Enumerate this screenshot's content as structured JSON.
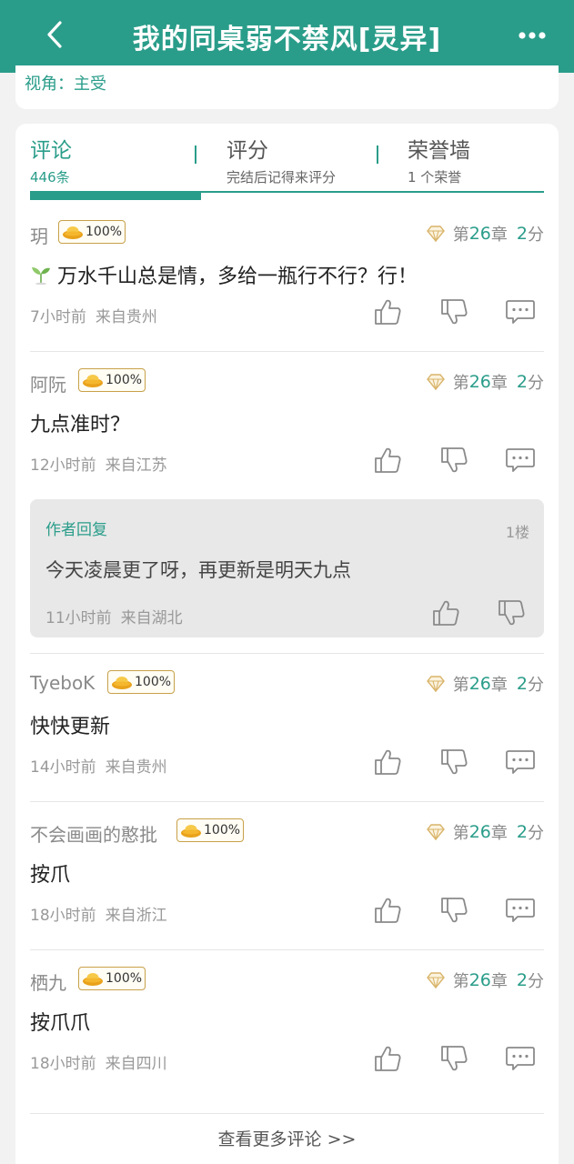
{
  "header": {
    "title": "我的同桌弱不禁风[灵异]"
  },
  "info": {
    "pov": "视角：主受"
  },
  "tabs": [
    {
      "label": "评论",
      "sub": "446条"
    },
    {
      "label": "评分",
      "sub": "完结后记得来评分"
    },
    {
      "label": "荣誉墙",
      "sub": "1 个荣誉"
    }
  ],
  "comments": [
    {
      "user": "玥",
      "badge": "100%",
      "chapter_pre": "第",
      "chapter_num": "26",
      "chapter_post": "章",
      "score_num": "2",
      "score_unit": "分",
      "text": "万水千山总是情，多给一瓶行不行？行！",
      "time": "7小时前",
      "location": "来自贵州"
    },
    {
      "user": "阿阮",
      "badge": "100%",
      "chapter_pre": "第",
      "chapter_num": "26",
      "chapter_post": "章",
      "score_num": "2",
      "score_unit": "分",
      "text": "九点准时？",
      "time": "12小时前",
      "location": "来自江苏"
    },
    {
      "user": "TyeboK",
      "badge": "100%",
      "chapter_pre": "第",
      "chapter_num": "26",
      "chapter_post": "章",
      "score_num": "2",
      "score_unit": "分",
      "text": "快快更新",
      "time": "14小时前",
      "location": "来自贵州"
    },
    {
      "user": "不会画画的憨批",
      "badge": "100%",
      "chapter_pre": "第",
      "chapter_num": "26",
      "chapter_post": "章",
      "score_num": "2",
      "score_unit": "分",
      "text": "按爪",
      "time": "18小时前",
      "location": "来自浙江"
    },
    {
      "user": "栖九",
      "badge": "100%",
      "chapter_pre": "第",
      "chapter_num": "26",
      "chapter_post": "章",
      "score_num": "2",
      "score_unit": "分",
      "text": "按爪爪",
      "time": "18小时前",
      "location": "来自四川"
    }
  ],
  "reply": {
    "title": "作者回复",
    "floor": "1楼",
    "text": "今天凌晨更了呀，再更新是明天九点",
    "time": "11小时前",
    "location": "来自湖北"
  },
  "footer": {
    "more": "查看更多评论 >>"
  },
  "colors": {
    "accent": "#2a9d8a",
    "gold": "#f0b429"
  },
  "icons": [
    "back-arrow-icon",
    "more-dots-icon",
    "gold-ingot-icon",
    "diamond-icon",
    "thumb-up-icon",
    "thumb-down-icon",
    "comment-icon",
    "sprout-icon"
  ]
}
